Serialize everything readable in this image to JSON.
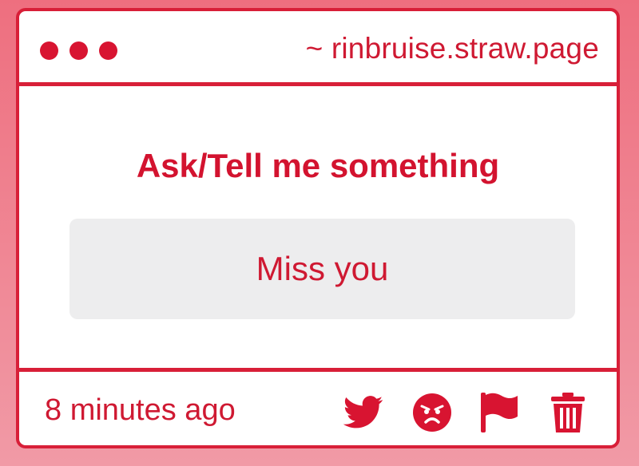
{
  "header": {
    "url": "~ rinbruise.straw.page"
  },
  "main": {
    "question": "Ask/Tell me something",
    "answer": "Miss you"
  },
  "footer": {
    "time": "8 minutes ago",
    "actions": [
      "twitter-icon",
      "angry-face-icon",
      "flag-icon",
      "trash-icon"
    ]
  },
  "colors": {
    "accent": "#d81f38",
    "background": "#ee6f7f",
    "answer_box": "#ededee"
  }
}
